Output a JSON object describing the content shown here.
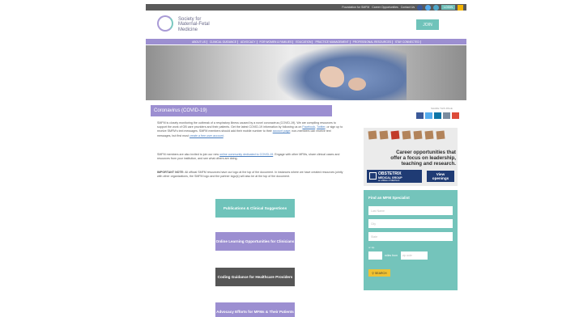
{
  "topbar": {
    "links": [
      "Foundation for SMFM",
      "Career Opportunities",
      "Contact Us"
    ],
    "social": [
      "facebook-icon",
      "twitter-icon",
      "instagram-icon"
    ],
    "login": "LOGIN",
    "search_icon": "search-icon"
  },
  "header": {
    "logo_line1": "Society for",
    "logo_line2": "Maternal-Fetal",
    "logo_line3": "Medicine",
    "join": "JOIN"
  },
  "nav": {
    "items": [
      "ABOUT US",
      "CLINICAL GUIDANCE",
      "ADVOCACY",
      "FOR WOMEN & FAMILIES",
      "EDUCATION",
      "PRACTICE MANAGEMENT",
      "PROFESSIONAL RESOURCES",
      "STAY CONNECTED"
    ]
  },
  "page": {
    "title": "Coronavirus (COVID-19)",
    "share_label": "SHARE THIS PAGE",
    "share": [
      "facebook-icon",
      "twitter-icon",
      "linkedin-icon",
      "email-icon",
      "plus-icon"
    ],
    "share_colors": [
      "#3b5998",
      "#55acee",
      "#0e76a8",
      "#7b8da0",
      "#dd4b39"
    ]
  },
  "body": {
    "p1_a": "SMFM is closely monitoring the outbreak of a respiratory illness caused by a novel coronavirus (COVID-19). We are compiling resources to support the work of OB care providers and their patients. Get the latest COVID-19 information by following us on",
    "p1_facebook": "Facebook",
    "p1_b": ",",
    "p1_twitter": "Twitter",
    "p1_c": ", or sign up to receive SMFM's text messages. SMFM members should add their mobile number to their",
    "p1_account": "account page",
    "p1_d": "; non-members can receive text messages, but first must",
    "p1_create": "create a free user account",
    "p1_e": ".",
    "p2_a": "SMFM members are also invited to join our new",
    "p2_link": "online community dedicated to COVID-19",
    "p2_b": ". Engage with other MFMs, share clinical cases and resources from your institution, and see what others are doing.",
    "p3_bold": "IMPORTANT NOTE:",
    "p3_text": " All official SMFM resources have our logo at the top of the document. In instances where we have created resources jointly with other organizations, the SMFM logo and the partner logo(s) will also be at the top of the document."
  },
  "buttons": {
    "b1": "Publications & Clinical Suggestions",
    "b2": "Online Learning Opportunities for Clinicians",
    "b3": "Coding Guidance for Healthcare Providers",
    "b4": "Advocacy Efforts for MFMs & Their Patients"
  },
  "ad": {
    "line1": "Career opportunities that",
    "line2": "offer a focus on leadership,",
    "line3": "teaching and research.",
    "logo1": "OBSTETRIX",
    "logo2": "MEDICAL GROUP",
    "logo3": "an affiliate of MEDNAX",
    "cta1": "View",
    "cta2": "openings"
  },
  "find": {
    "title": "Find an MFM Specialist",
    "last_name": "Last Name",
    "city": "City",
    "state": "State",
    "or_label": "or zip",
    "miles": "miles from",
    "zip_placeholder": "zip code",
    "search": "SEARCH"
  }
}
